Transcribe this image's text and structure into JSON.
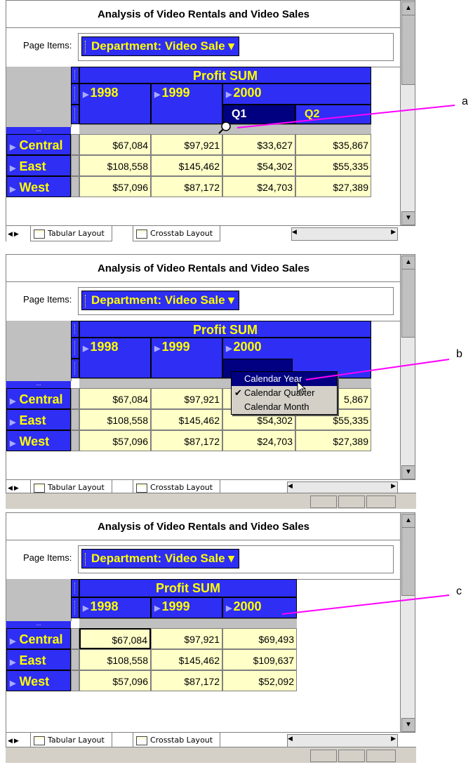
{
  "common": {
    "window_title": "Analysis of Video Rentals and Video Sales",
    "page_items_label": "Page Items:",
    "page_item_value": "Department: Video Sale",
    "measure_header": "Profit SUM",
    "years": [
      "1998",
      "1999",
      "2000"
    ],
    "rows": [
      "Central",
      "East",
      "West"
    ],
    "tabs": [
      "Tabular Layout",
      "Crosstab Layout"
    ],
    "header_dots": "...",
    "colors": {
      "header_blue": "#2e2ef4",
      "header_text": "#ffff00",
      "cell_bg": "#ffffc8",
      "callout_line": "#ff00ff",
      "selected_quarter": "#000080"
    }
  },
  "panel_a": {
    "callout": "a",
    "quarters": [
      "Q1",
      "Q2"
    ],
    "values": [
      [
        "$67,084",
        "$97,921",
        "$33,627",
        "$35,867"
      ],
      [
        "$108,558",
        "$145,462",
        "$54,302",
        "$55,335"
      ],
      [
        "$57,096",
        "$87,172",
        "$24,703",
        "$27,389"
      ]
    ]
  },
  "panel_b": {
    "callout": "b",
    "values": [
      [
        "$67,084",
        "$97,921",
        "",
        "5,867"
      ],
      [
        "$108,558",
        "$145,462",
        "$54,302",
        "$55,335"
      ],
      [
        "$57,096",
        "$87,172",
        "$24,703",
        "$27,389"
      ]
    ],
    "context_menu": [
      {
        "label": "Calendar Year",
        "checked": false,
        "highlighted": true
      },
      {
        "label": "Calendar Quarter",
        "checked": true,
        "highlighted": false
      },
      {
        "label": "Calendar Month",
        "checked": false,
        "highlighted": false
      }
    ]
  },
  "panel_c": {
    "callout": "c",
    "values": [
      [
        "$67,084",
        "$97,921",
        "$69,493"
      ],
      [
        "$108,558",
        "$145,462",
        "$109,637"
      ],
      [
        "$57,096",
        "$87,172",
        "$52,092"
      ]
    ]
  }
}
